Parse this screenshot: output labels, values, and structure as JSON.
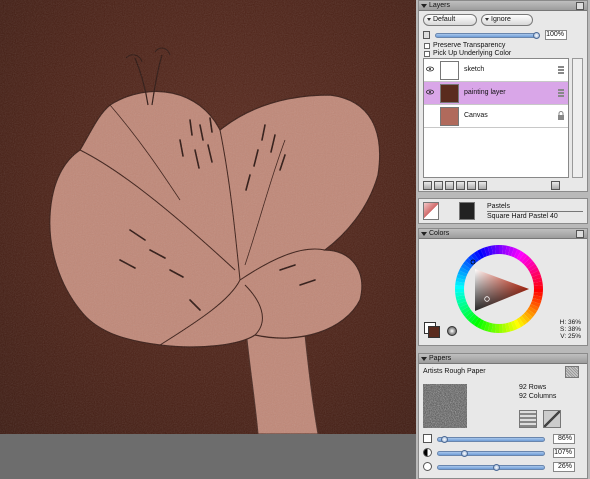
{
  "layers_panel": {
    "title": "Layers",
    "composite_method": "Default",
    "composite_depth": "Ignore",
    "opacity_value": "100%",
    "preserve_transparency_label": "Preserve Transparency",
    "pick_up_underlying_label": "Pick Up Underlying Color",
    "layers": [
      {
        "name": "sketch",
        "selected": false
      },
      {
        "name": "painting layer",
        "selected": true
      },
      {
        "name": "Canvas",
        "selected": false
      }
    ]
  },
  "brush_panel": {
    "category": "Pastels",
    "variant": "Square Hard Pastel 40"
  },
  "colors_panel": {
    "title": "Colors",
    "hue_readout": "H: 36%",
    "sat_readout": "S: 38%",
    "val_readout": "V: 25%",
    "main_color": "#5a2b1e",
    "secondary_color": "#ffffff"
  },
  "papers_panel": {
    "title": "Papers",
    "paper_name": "Artists Rough Paper",
    "rows_label": "92 Rows",
    "columns_label": "92 Columns",
    "scale_value": "86%",
    "contrast_value": "107%",
    "brightness_value": "26%"
  },
  "document": {
    "background_color": "#4a2015",
    "petal_color": "#c08878"
  }
}
